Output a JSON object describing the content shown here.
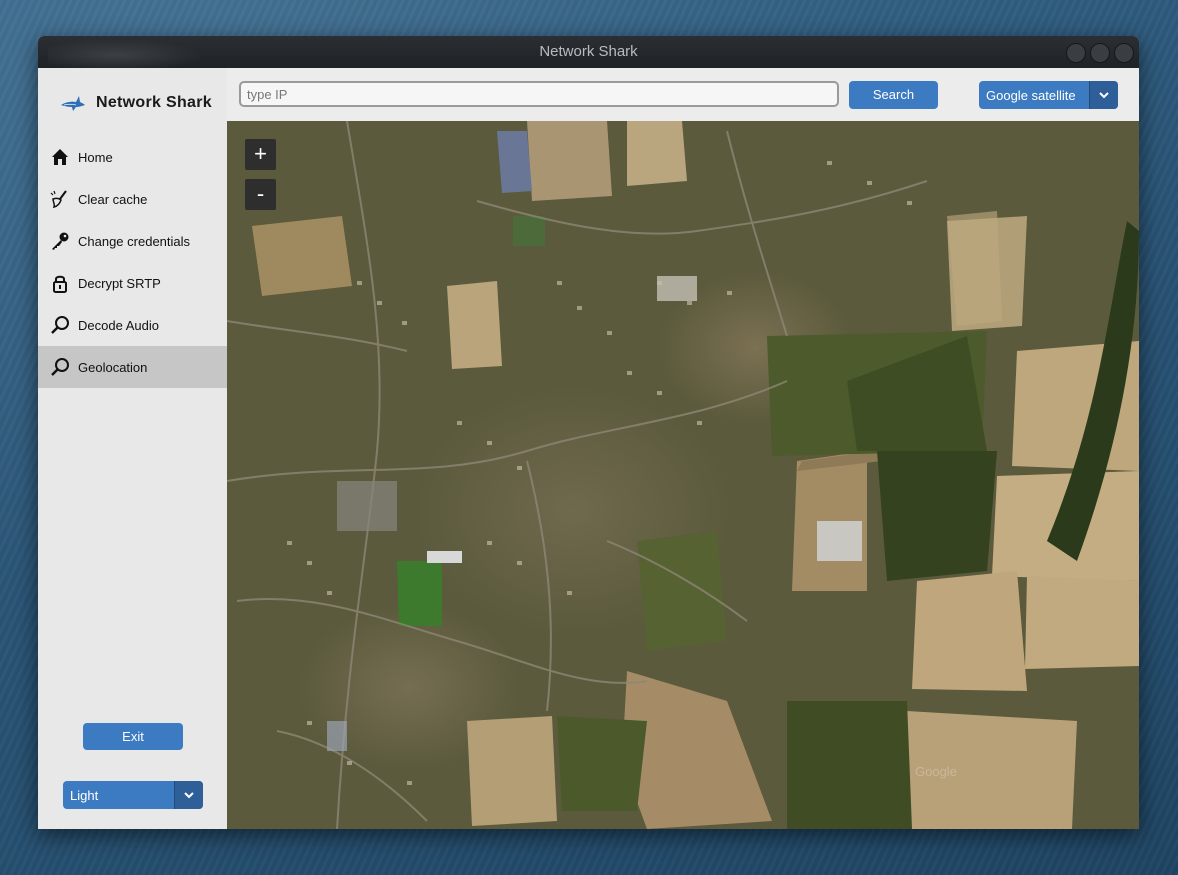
{
  "window": {
    "title": "Network Shark"
  },
  "sidebar": {
    "brand": "Network Shark",
    "items": [
      {
        "label": "Home",
        "icon": "home-icon"
      },
      {
        "label": "Clear cache",
        "icon": "broom-icon"
      },
      {
        "label": "Change credentials",
        "icon": "key-icon"
      },
      {
        "label": "Decrypt SRTP",
        "icon": "lock-icon"
      },
      {
        "label": "Decode Audio",
        "icon": "magnifier-icon"
      },
      {
        "label": "Geolocation",
        "icon": "magnifier-icon",
        "active": true
      }
    ],
    "exit_label": "Exit",
    "theme": {
      "selected": "Light"
    }
  },
  "topbar": {
    "search_placeholder": "type IP",
    "search_value": "",
    "search_button": "Search",
    "map_type": {
      "selected": "Google satellite"
    }
  },
  "map": {
    "zoom_in": "+",
    "zoom_out": "-",
    "watermark": "Google"
  },
  "colors": {
    "accent": "#3c7bc1",
    "sidebar_active": "#c6c6c6",
    "titlebar": "#24282c"
  }
}
